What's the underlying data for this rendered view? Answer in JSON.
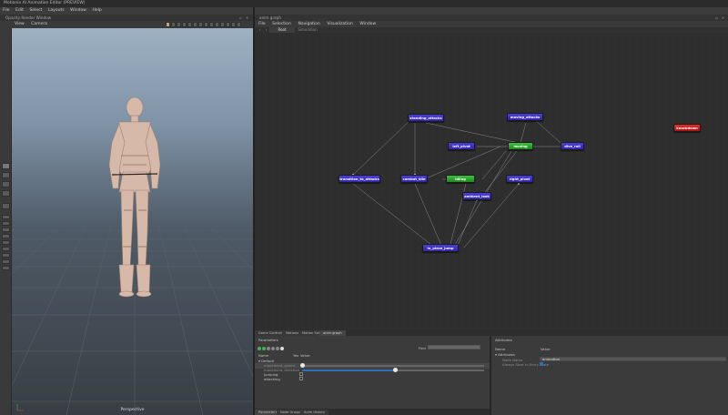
{
  "window": {
    "title": "Motionix AI Animation Editor (PREVIEW)"
  },
  "menu": [
    "File",
    "Edit",
    "Select",
    "Layouts",
    "Window",
    "Help"
  ],
  "viewport": {
    "title": "Opacity Render Window",
    "menu": [
      "View",
      "Camera"
    ],
    "label": "Perspective"
  },
  "graph_panel": {
    "title": "anim graph",
    "menu": [
      "File",
      "Selection",
      "Navigation",
      "Visualization",
      "Window"
    ],
    "tabs": [
      "Root",
      "Simulation"
    ],
    "nodes": [
      "standing_attacks",
      "moving_attacks",
      "left_pivot",
      "moving",
      "dive_roll",
      "transition_to_attacks",
      "combat_idle",
      "idling",
      "right_pivot",
      "ambient_look",
      "in_place_jump",
      "knockdown"
    ]
  },
  "bottom": {
    "tabs": [
      "Game Controller",
      "Motions",
      "Motion Sets",
      "anim graph"
    ],
    "subtabs": [
      "Parameters",
      "Node Groups",
      "Anim History"
    ]
  },
  "parameters": {
    "title": "Parameters",
    "find_label": "Find",
    "col_name": "Name",
    "col_yes": "Yes",
    "col_value": "Value",
    "group": "Default",
    "params": [
      "movement_speed",
      "movement_direction",
      "jumping",
      "attacking"
    ],
    "values": {
      "movement_speed": 0.0,
      "movement_direction": 0.4
    }
  },
  "attributes": {
    "title": "Attributes",
    "col_name": "Name",
    "col_value": "Value",
    "group": "Attributes",
    "rows": [
      {
        "name": "Node Name",
        "value": "animation"
      },
      {
        "name": "Always Start In Entry State",
        "value": ""
      }
    ]
  },
  "colors": {
    "node_purple": "#3c2fc4",
    "node_green": "#2ea52e",
    "node_red": "#c81c1c",
    "accent_blue": "#2d6fbd"
  }
}
